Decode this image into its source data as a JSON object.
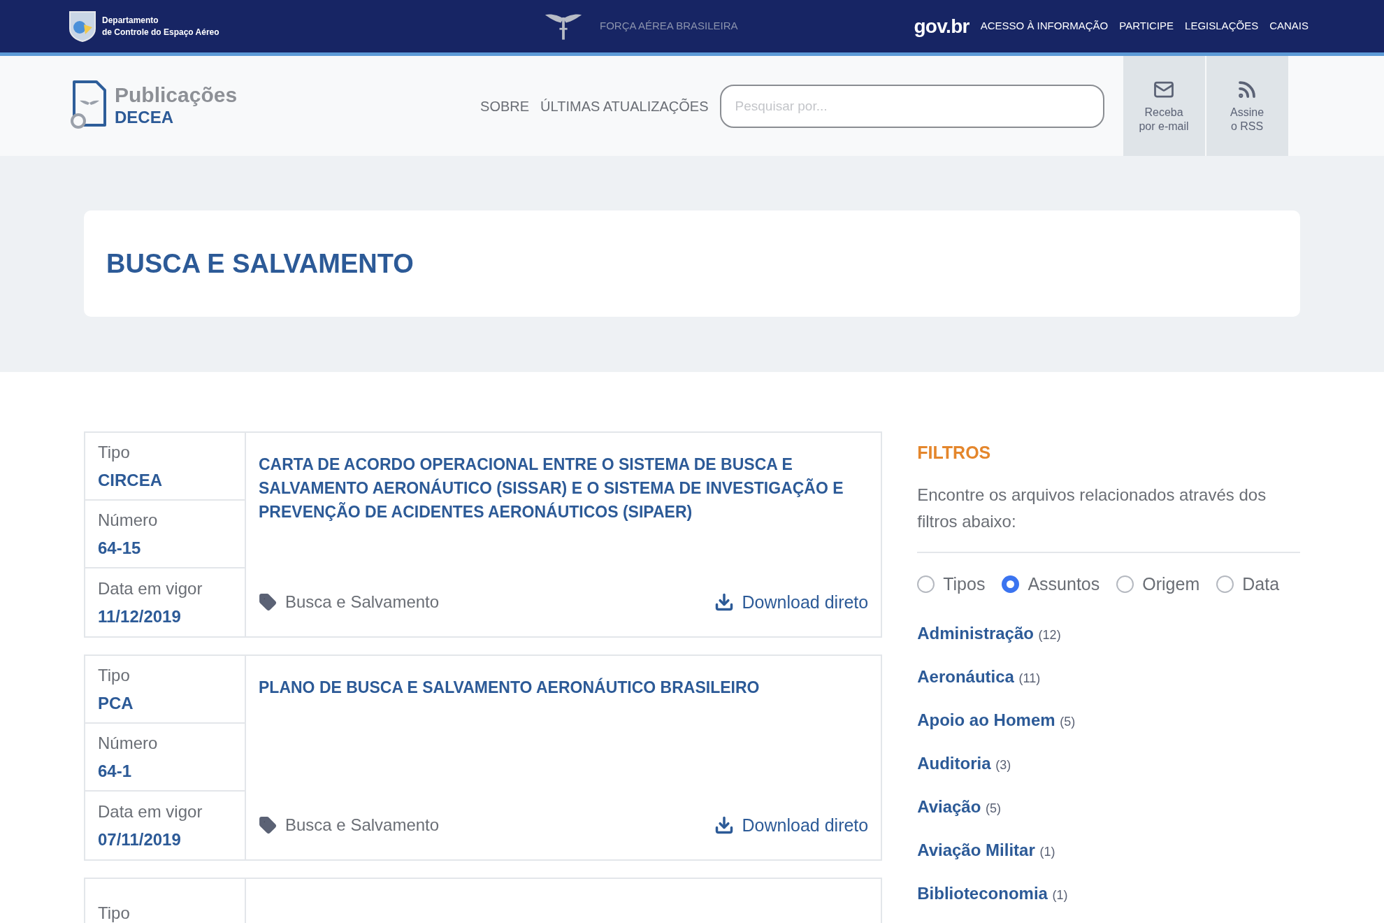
{
  "top_bar": {
    "org_line_1": "Departamento",
    "org_line_2": "de Controle do Espaço Aéreo",
    "center_label": "FORÇA AÉREA BRASILEIRA",
    "gov_logo": "gov.br",
    "links": [
      "ACESSO À INFORMAÇÃO",
      "PARTICIPE",
      "LEGISLAÇÕES",
      "CANAIS"
    ]
  },
  "header": {
    "logo_title": "Publicações",
    "logo_subtitle": "DECEA",
    "nav": [
      "SOBRE",
      "ÚLTIMAS ATUALIZAÇÕES"
    ],
    "search": {
      "placeholder": "Pesquisar por..."
    },
    "actions": [
      {
        "kind": "email",
        "line_1": "Receba",
        "line_2": "por e-mail"
      },
      {
        "kind": "rss",
        "line_1": "Assine",
        "line_2": "o RSS"
      }
    ]
  },
  "page_title": "BUSCA E SALVAMENTO",
  "publications": [
    {
      "fields": [
        {
          "label": "Tipo",
          "value": "CIRCEA"
        },
        {
          "label": "Número",
          "value": "64-15"
        },
        {
          "label": "Data em vigor",
          "value": "11/12/2019"
        }
      ],
      "title": "CARTA DE ACORDO OPERACIONAL ENTRE O SISTEMA DE BUSCA E SALVAMENTO AERONÁUTICO (SISSAR) E O SISTEMA DE INVESTIGAÇÃO E PREVENÇÃO DE ACIDENTES AERONÁUTICOS (SIPAER)",
      "tag": "Busca e Salvamento",
      "download": "Download direto"
    },
    {
      "fields": [
        {
          "label": "Tipo",
          "value": "PCA"
        },
        {
          "label": "Número",
          "value": "64-1"
        },
        {
          "label": "Data em vigor",
          "value": "07/11/2019"
        }
      ],
      "title": "PLANO DE BUSCA E SALVAMENTO AERONÁUTICO BRASILEIRO",
      "tag": "Busca e Salvamento",
      "download": "Download direto"
    },
    {
      "fields": [
        {
          "label": "Tipo"
        }
      ]
    }
  ],
  "filters": {
    "heading": "FILTROS",
    "description": "Encontre os arquivos relacionados através dos filtros abaixo:",
    "options": [
      {
        "label": "Tipos",
        "selected": false
      },
      {
        "label": "Assuntos",
        "selected": true
      },
      {
        "label": "Origem",
        "selected": false
      },
      {
        "label": "Data",
        "selected": false
      }
    ],
    "subjects": [
      {
        "name": "Administração",
        "count": "(12)"
      },
      {
        "name": "Aeronáutica",
        "count": "(11)"
      },
      {
        "name": "Apoio ao Homem",
        "count": "(5)"
      },
      {
        "name": "Auditoria",
        "count": "(3)"
      },
      {
        "name": "Aviação",
        "count": "(5)"
      },
      {
        "name": "Aviação Militar",
        "count": "(1)"
      },
      {
        "name": "Biblioteconomia",
        "count": "(1)"
      }
    ]
  }
}
